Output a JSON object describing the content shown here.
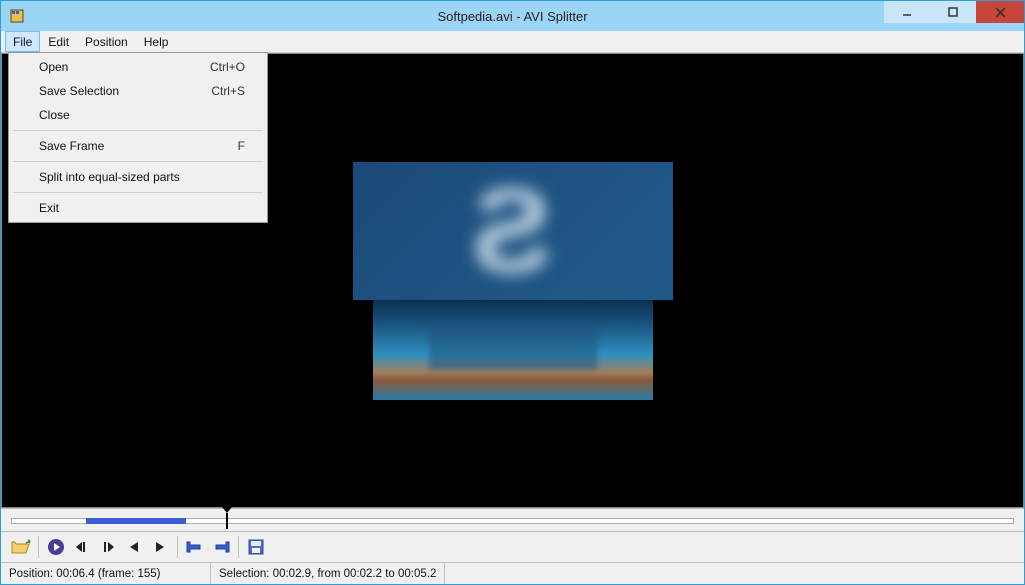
{
  "window": {
    "title": "Softpedia.avi - AVI Splitter"
  },
  "menubar": {
    "file": "File",
    "edit": "Edit",
    "position": "Position",
    "help": "Help"
  },
  "file_menu": {
    "open": {
      "label": "Open",
      "shortcut": "Ctrl+O"
    },
    "save_selection": {
      "label": "Save Selection",
      "shortcut": "Ctrl+S"
    },
    "close": {
      "label": "Close",
      "shortcut": ""
    },
    "save_frame": {
      "label": "Save Frame",
      "shortcut": "F"
    },
    "split_equal": {
      "label": "Split into equal-sized parts",
      "shortcut": ""
    },
    "exit": {
      "label": "Exit",
      "shortcut": ""
    }
  },
  "status": {
    "position": "Position: 00:06.4 (frame: 155)",
    "selection": "Selection: 00:02.9, from 00:02.2 to 00:05.2"
  },
  "timeline": {
    "selection_start_pct": 8,
    "selection_width_pct": 10,
    "playhead_pct": 22
  },
  "colors": {
    "titlebar": "#9bd4f5",
    "close": "#c8453b",
    "selection": "#3a5cd0"
  }
}
